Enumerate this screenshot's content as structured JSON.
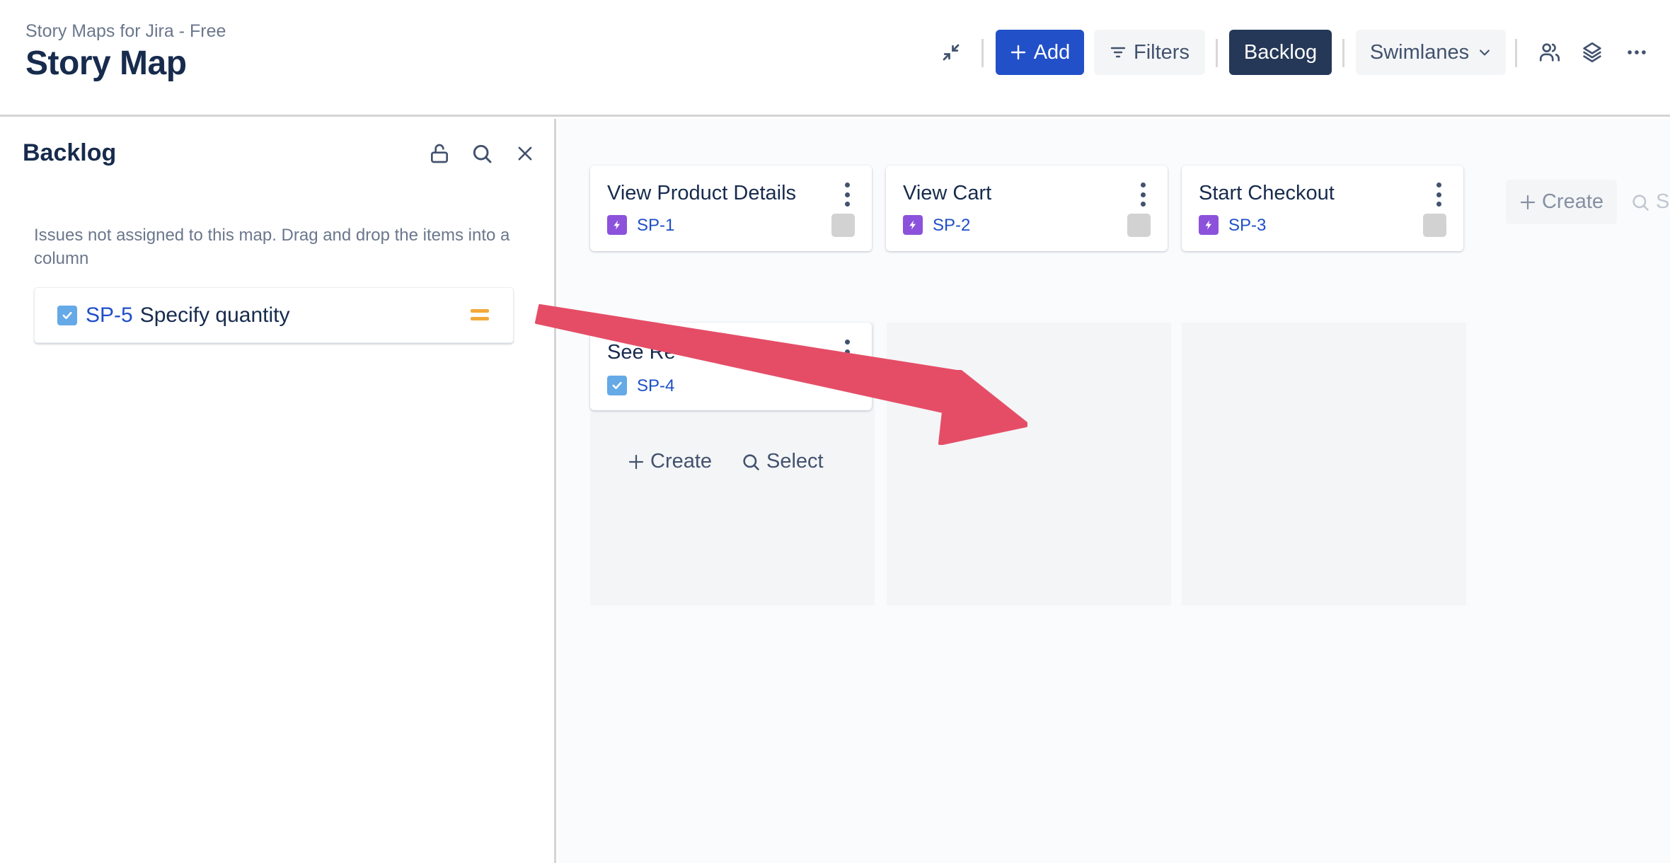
{
  "header": {
    "app_name": "Story Maps for Jira - Free",
    "title": "Story Map",
    "toolbar": {
      "collapse_icon": "compress-arrows-icon",
      "add_label": "Add",
      "filters_label": "Filters",
      "backlog_label": "Backlog",
      "swimlanes_label": "Swimlanes",
      "people_icon": "people-icon",
      "layers_icon": "layers-icon",
      "more_icon": "more-horizontal-icon"
    }
  },
  "sidebar": {
    "title": "Backlog",
    "icons": [
      "unlock-icon",
      "search-icon",
      "close-icon"
    ],
    "description": "Issues not assigned to this map. Drag and drop the items into a column",
    "items": [
      {
        "key": "SP-5",
        "title": "Specify quantity",
        "type": "task",
        "priority": "medium"
      }
    ]
  },
  "board": {
    "epics": [
      {
        "title": "View Product Details",
        "key": "SP-1",
        "type": "epic"
      },
      {
        "title": "View Cart",
        "key": "SP-2",
        "type": "epic"
      },
      {
        "title": "Start Checkout",
        "key": "SP-3",
        "type": "epic"
      }
    ],
    "epic_row_actions": {
      "create_label": "Create",
      "select_label": "S"
    },
    "columns": [
      {
        "stories": [
          {
            "title": "See Re",
            "key": "SP-4",
            "type": "task"
          }
        ],
        "create_label": "Create",
        "select_label": "Select"
      },
      {
        "stories": []
      },
      {
        "stories": []
      }
    ]
  },
  "annotation": {
    "type": "arrow",
    "color": "#e54d67"
  },
  "colors": {
    "primary": "#2150c8",
    "dark": "#253858",
    "epic": "#8c52db",
    "task": "#65a9e7",
    "priority_medium": "#f2a93b",
    "link": "#1f4fc7"
  }
}
